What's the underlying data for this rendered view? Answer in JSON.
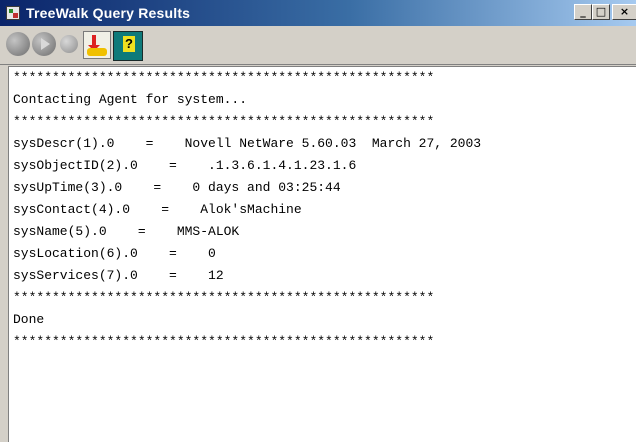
{
  "window": {
    "title": "TreeWalk Query Results",
    "minimize_glyph": "_",
    "maximize_glyph": "□",
    "close_glyph": "×"
  },
  "toolbar": {
    "buttons": [
      {
        "icon": "stop-icon"
      },
      {
        "icon": "play-icon"
      },
      {
        "icon": "pause-icon"
      },
      {
        "icon": "walk-icon"
      },
      {
        "icon": "help-icon",
        "glyph": "?"
      }
    ]
  },
  "output": {
    "lines": [
      "******************************************************",
      "Contacting Agent for system...",
      "******************************************************",
      "sysDescr(1).0    =    Novell NetWare 5.60.03  March 27, 2003",
      "sysObjectID(2).0    =    .1.3.6.1.4.1.23.1.6",
      "sysUpTime(3).0    =    0 days and 03:25:44",
      "sysContact(4).0    =    Alok'sMachine",
      "sysName(5).0    =    MMS-ALOK",
      "sysLocation(6).0    =    0",
      "sysServices(7).0    =    12",
      "******************************************************",
      "Done",
      "******************************************************"
    ]
  }
}
